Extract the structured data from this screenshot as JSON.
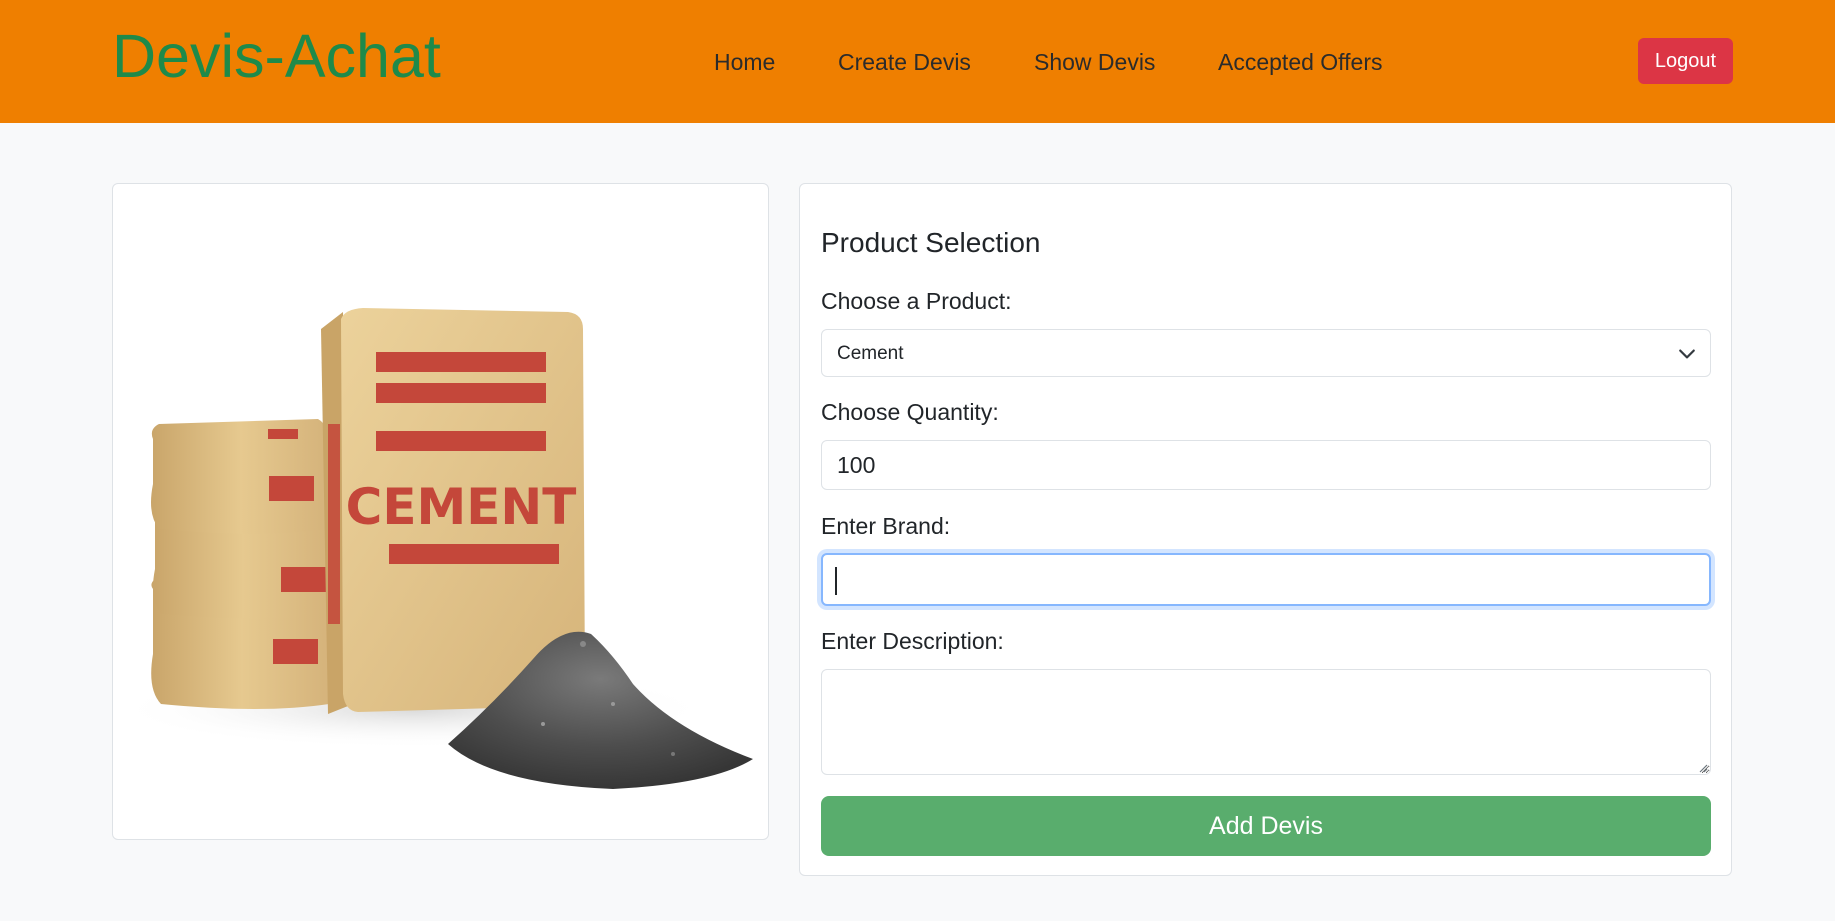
{
  "navbar": {
    "brand": "Devis-Achat",
    "links": [
      "Home",
      "Create Devis",
      "Show Devis",
      "Accepted Offers"
    ],
    "logout_label": "Logout",
    "background_color": "#ef7f00",
    "brand_color": "#1e8a4a",
    "logout_color": "#dc3545"
  },
  "product_image": {
    "depicts": "cement bags with cement powder pile",
    "bag_label": "CEMENT",
    "icon": "product-photo"
  },
  "form": {
    "title": "Product Selection",
    "product_label": "Choose a Product:",
    "product_selected": "Cement",
    "quantity_label": "Choose Quantity:",
    "quantity_value": "100",
    "brand_label": "Enter Brand:",
    "brand_value": "",
    "description_label": "Enter Description:",
    "description_value": "",
    "submit_label": "Add Devis",
    "submit_color": "#59ad6d",
    "focus_color": "#86b7fe"
  }
}
